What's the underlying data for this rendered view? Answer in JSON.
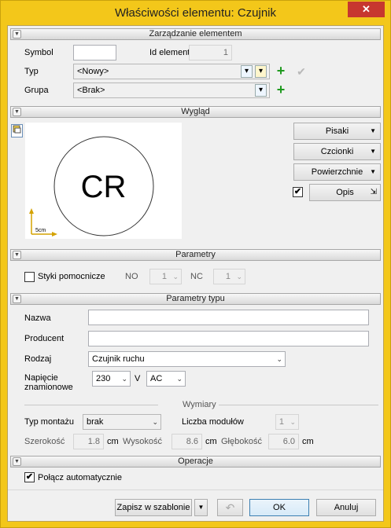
{
  "window": {
    "title": "Właściwości elementu: Czujnik",
    "close_glyph": "✕"
  },
  "sections": {
    "management": "Zarządzanie elementem",
    "appearance": "Wygląd",
    "parameters": "Parametry",
    "type_parameters": "Parametry typu",
    "operations": "Operacje"
  },
  "management": {
    "symbol_label": "Symbol",
    "symbol_value": "",
    "id_label": "Id elementu",
    "id_value": "1",
    "type_label": "Typ",
    "type_value": "<Nowy>",
    "group_label": "Grupa",
    "group_value": "<Brak>"
  },
  "appearance": {
    "symbol_text": "CR",
    "scale_label": "5cm",
    "pens_label": "Pisaki",
    "fonts_label": "Czcionki",
    "surfaces_label": "Powierzchnie",
    "description_label": "Opis",
    "description_checked": true
  },
  "parameters": {
    "aux_contacts_label": "Styki pomocnicze",
    "aux_contacts_checked": false,
    "no_label": "NO",
    "no_value": "1",
    "nc_label": "NC",
    "nc_value": "1"
  },
  "type_params": {
    "name_label": "Nazwa",
    "name_value": "",
    "producer_label": "Producent",
    "producer_value": "",
    "kind_label": "Rodzaj",
    "kind_value": "Czujnik ruchu",
    "voltage_label": "Napięcie znamionowe",
    "voltage_value": "230",
    "voltage_unit": "V",
    "current_type": "AC",
    "dimensions_label": "Wymiary",
    "mount_label": "Typ montażu",
    "mount_value": "brak",
    "modules_label": "Liczba modułów",
    "modules_value": "1",
    "width_label": "Szerokość",
    "width_value": "1.8",
    "height_label": "Wysokość",
    "height_value": "8.6",
    "depth_label": "Głębokość",
    "depth_value": "6.0",
    "unit_cm": "cm"
  },
  "operations": {
    "auto_connect_label": "Połącz automatycznie",
    "auto_connect_checked": true
  },
  "footer": {
    "save_template_label": "Zapisz w szablonie",
    "ok_label": "OK",
    "cancel_label": "Anuluj"
  }
}
